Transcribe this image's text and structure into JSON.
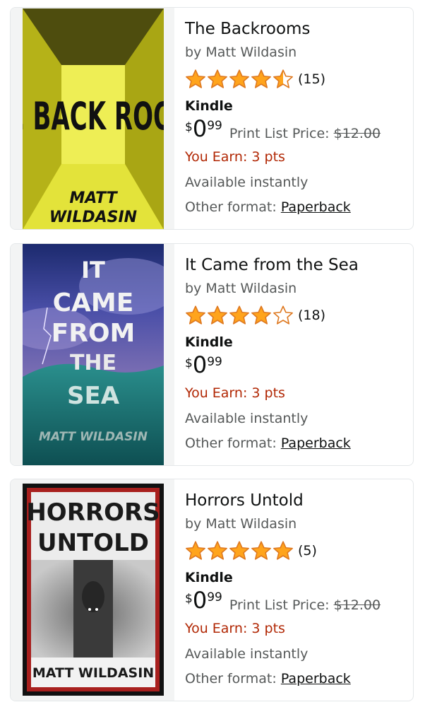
{
  "colors": {
    "star": "#ffa41c",
    "star_outline": "#de7921",
    "earn": "#b12704",
    "muted": "#565959",
    "text": "#0f1111"
  },
  "books": [
    {
      "title": "The Backrooms",
      "author": "by Matt Wildasin",
      "rating_stars": 4.5,
      "rating_count": "(15)",
      "format": "Kindle",
      "price_symbol": "$",
      "price_whole": "0",
      "price_fraction": "99",
      "list_price_label": "Print List Price:",
      "list_price_value": "$12.00",
      "earn": "You Earn: 3 pts",
      "availability": "Available instantly",
      "other_format_label": "Other format:",
      "other_format_link": "Paperback",
      "cover_lines": [
        "THE BACK ROOMS",
        "MATT",
        "WILDASIN"
      ]
    },
    {
      "title": "It Came from the Sea",
      "author": "by Matt Wildasin",
      "rating_stars": 4,
      "rating_count": "(18)",
      "format": "Kindle",
      "price_symbol": "$",
      "price_whole": "0",
      "price_fraction": "99",
      "earn": "You Earn: 3 pts",
      "availability": "Available instantly",
      "other_format_label": "Other format:",
      "other_format_link": "Paperback",
      "cover_lines": [
        "IT",
        "CAME",
        "FROM",
        "THE",
        "SEA",
        "MATT WILDASIN"
      ]
    },
    {
      "title": "Horrors Untold",
      "author": "by Matt Wildasin",
      "rating_stars": 5,
      "rating_count": "(5)",
      "format": "Kindle",
      "price_symbol": "$",
      "price_whole": "0",
      "price_fraction": "99",
      "list_price_label": "Print List Price:",
      "list_price_value": "$12.00",
      "earn": "You Earn: 3 pts",
      "availability": "Available instantly",
      "other_format_label": "Other format:",
      "other_format_link": "Paperback",
      "cover_lines": [
        "HORRORS",
        "UNTOLD",
        "MATT WILDASIN"
      ]
    }
  ]
}
